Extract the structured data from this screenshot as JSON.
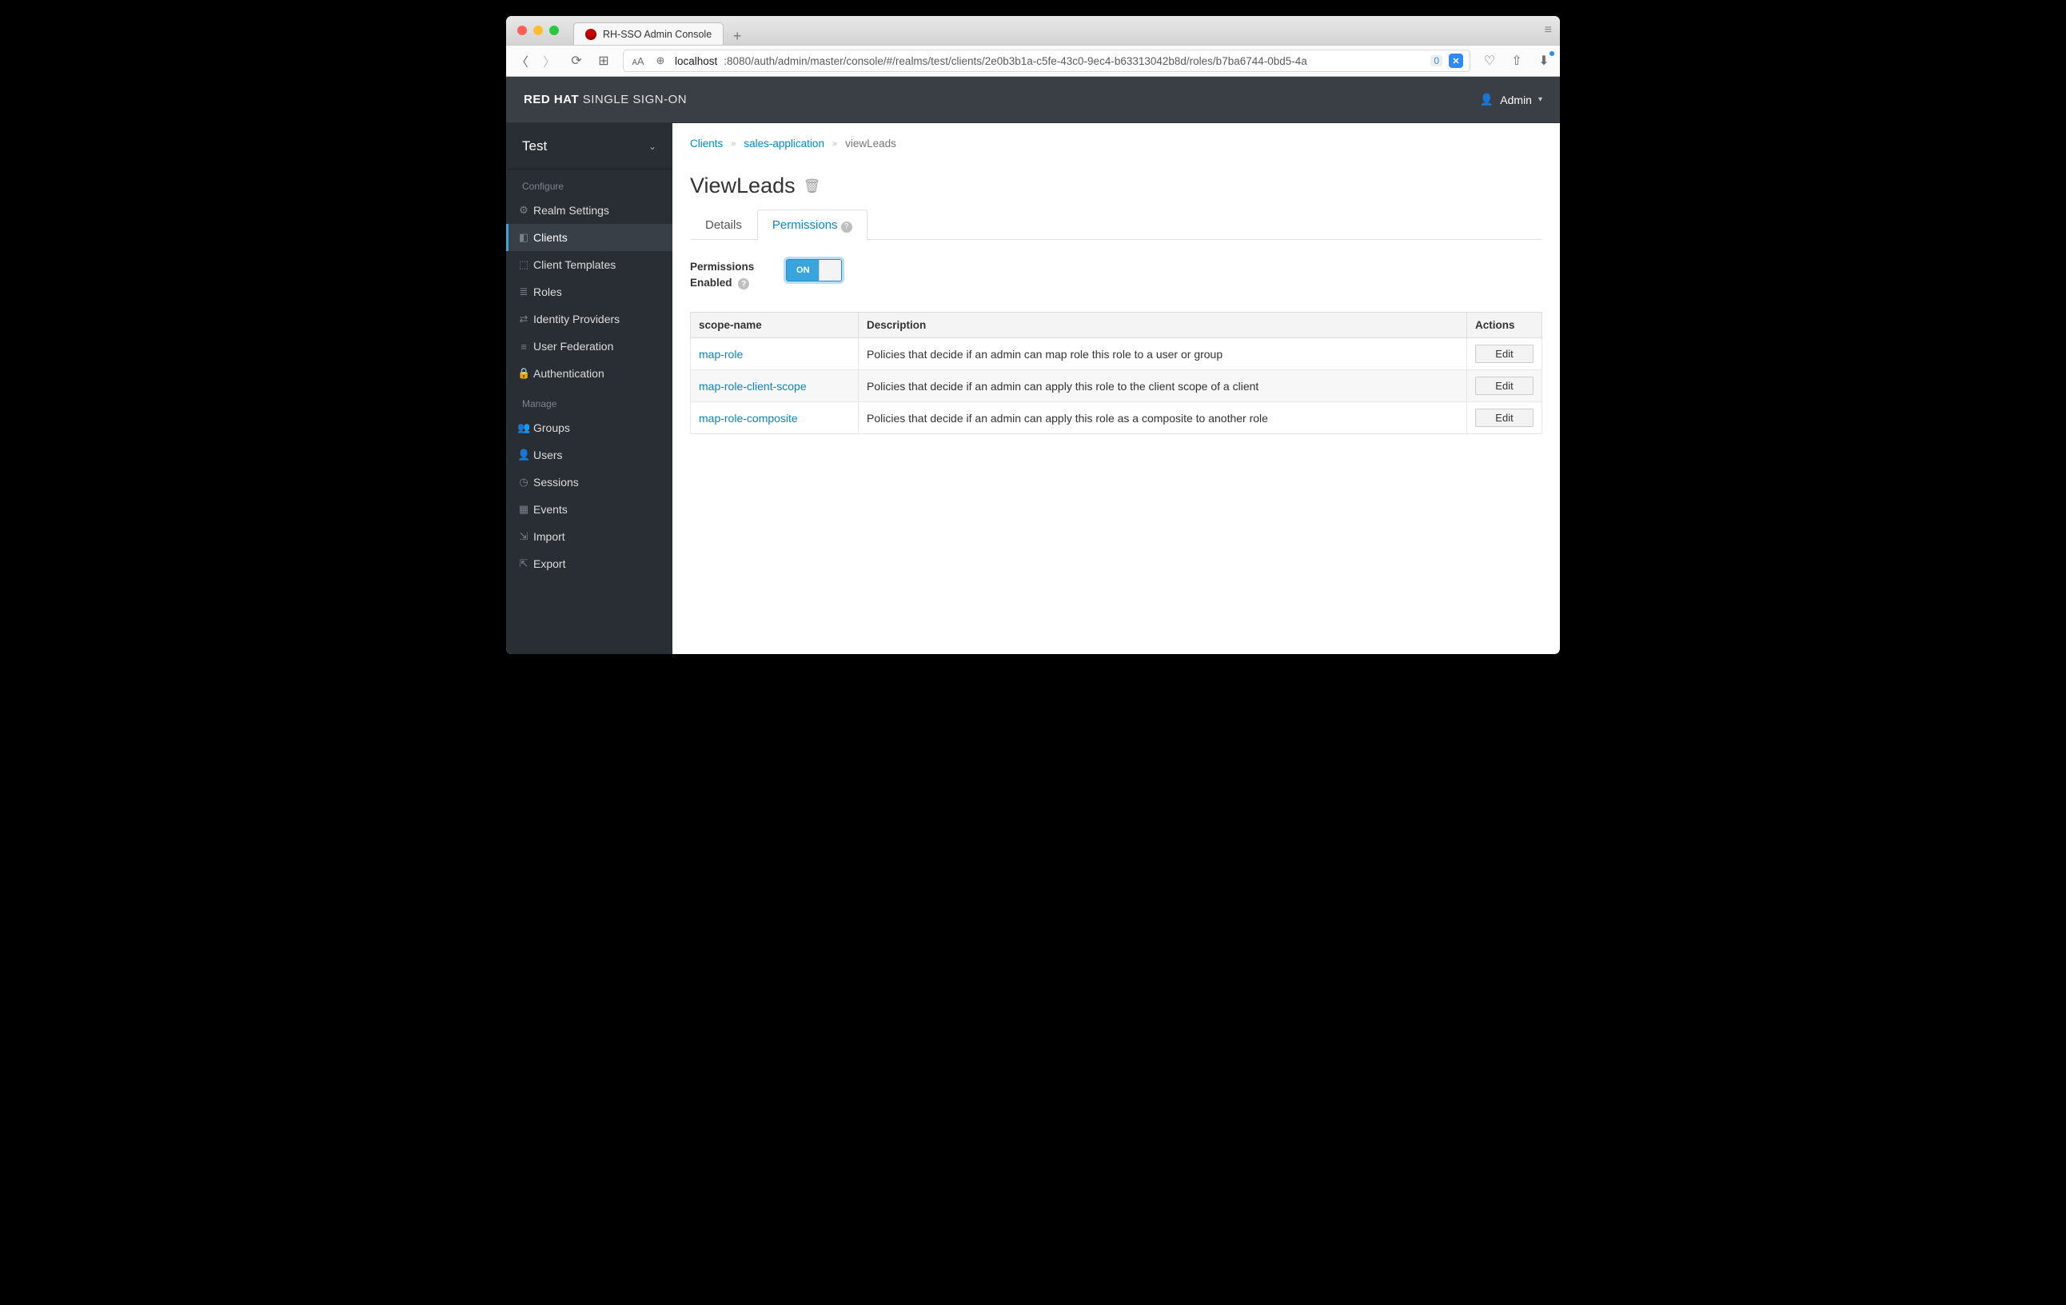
{
  "browser": {
    "tab_title": "RH-SSO Admin Console",
    "url_host": "localhost",
    "url_rest": ":8080/auth/admin/master/console/#/realms/test/clients/2e0b3b1a-c5fe-43c0-9ec4-b63313042b8d/roles/b7ba6744-0bd5-4a",
    "shield_badge": "✕",
    "zero_badge": "0"
  },
  "header": {
    "brand_bold": "RED HAT",
    "brand_rest": "SINGLE SIGN-ON",
    "user": "Admin"
  },
  "sidebar": {
    "realm": "Test",
    "sections": {
      "configure_label": "Configure",
      "manage_label": "Manage"
    },
    "configure": [
      {
        "icon": "⚙",
        "label": "Realm Settings"
      },
      {
        "icon": "◧",
        "label": "Clients",
        "active": true
      },
      {
        "icon": "⬚",
        "label": "Client Templates"
      },
      {
        "icon": "≣",
        "label": "Roles"
      },
      {
        "icon": "⇄",
        "label": "Identity Providers"
      },
      {
        "icon": "≡",
        "label": "User Federation"
      },
      {
        "icon": "🔒",
        "label": "Authentication"
      }
    ],
    "manage": [
      {
        "icon": "👥",
        "label": "Groups"
      },
      {
        "icon": "👤",
        "label": "Users"
      },
      {
        "icon": "◷",
        "label": "Sessions"
      },
      {
        "icon": "▦",
        "label": "Events"
      },
      {
        "icon": "⇲",
        "label": "Import"
      },
      {
        "icon": "⇱",
        "label": "Export"
      }
    ]
  },
  "breadcrumb": {
    "a": "Clients",
    "b": "sales-application",
    "c": "viewLeads"
  },
  "page_title": "ViewLeads",
  "tabs": {
    "details": "Details",
    "permissions": "Permissions"
  },
  "toggle": {
    "label_line1": "Permissions",
    "label_line2": "Enabled",
    "on_text": "ON"
  },
  "table": {
    "headers": {
      "scope": "scope-name",
      "desc": "Description",
      "actions": "Actions"
    },
    "edit_label": "Edit",
    "rows": [
      {
        "scope": "map-role",
        "desc": "Policies that decide if an admin can map role this role to a user or group"
      },
      {
        "scope": "map-role-client-scope",
        "desc": "Policies that decide if an admin can apply this role to the client scope of a client"
      },
      {
        "scope": "map-role-composite",
        "desc": "Policies that decide if an admin can apply this role as a composite to another role"
      }
    ]
  }
}
